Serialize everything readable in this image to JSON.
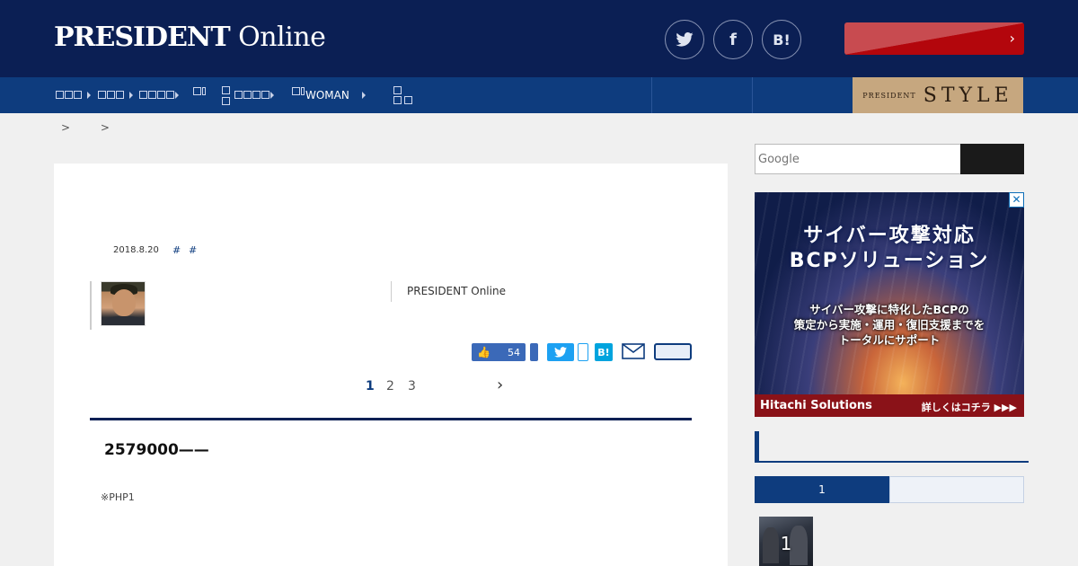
{
  "header": {
    "logo_main": "PRESIDENT",
    "logo_online": "Online",
    "social": [
      {
        "name": "twitter-icon",
        "glyph": "🐦"
      },
      {
        "name": "facebook-icon",
        "glyph": "f"
      },
      {
        "name": "hatena-icon",
        "glyph": "B!"
      }
    ],
    "cta_chevron": "›"
  },
  "nav": {
    "items": [
      {
        "label": "▯▯▯"
      },
      {
        "label": "▯▯▯"
      },
      {
        "label": "▯▯▯▯"
      },
      {
        "label": "▯▯▯▯▯"
      },
      {
        "label": "WOMAN"
      }
    ],
    "style_banner_small": "PRESIDENT",
    "style_banner_big": "STYLE"
  },
  "breadcrumb": [
    ">",
    ">"
  ],
  "article": {
    "date": "2018.8.20",
    "tags": [
      "#",
      "#"
    ],
    "source": "PRESIDENT Online",
    "like_count": "54",
    "hatena": "B!",
    "pages": [
      "1",
      "2",
      "3"
    ],
    "next_glyph": "›",
    "headline": "2579000——",
    "note": "※PHP1"
  },
  "sidebar": {
    "search_placeholder": "Google",
    "ad": {
      "title_line1": "サイバー攻撃対応",
      "title_line2": "BCPソリューション",
      "sub_line1": "サイバー攻撃に特化したBCPの",
      "sub_line2": "策定から実施・運用・復旧支援までを",
      "sub_line3": "トータルにサポート",
      "brand": "Hitachi Solutions",
      "more": "詳しくはコチラ ▶▶▶",
      "close": "✕"
    },
    "ranking_tab_active": "1",
    "ranking_first_number": "1"
  },
  "colors": {
    "header_bg": "#0b1f54",
    "nav_bg": "#0e3c7e",
    "cta_red": "#b3060c",
    "style_gold": "#c6a77f"
  }
}
